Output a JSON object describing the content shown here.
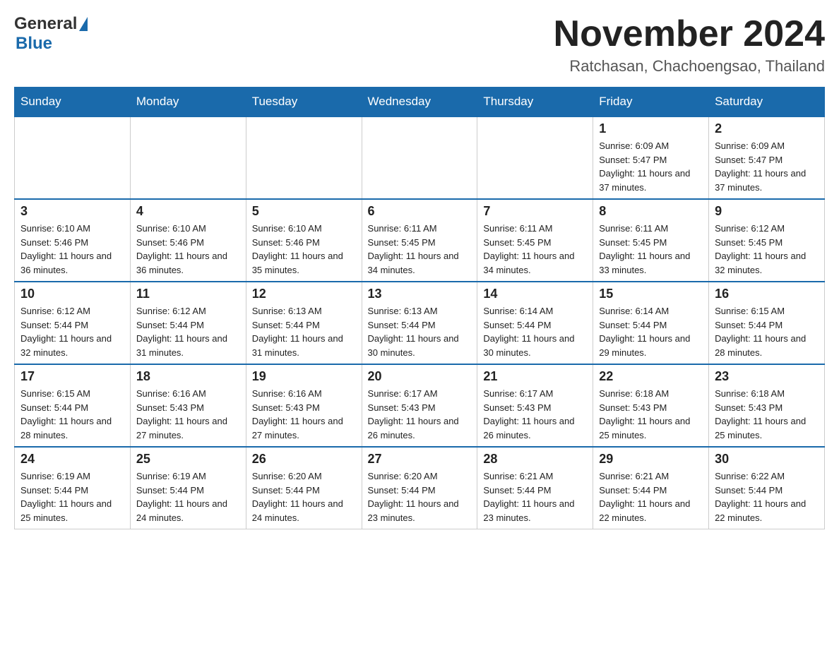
{
  "header": {
    "logo_general": "General",
    "logo_blue": "Blue",
    "month_title": "November 2024",
    "location": "Ratchasan, Chachoengsao, Thailand"
  },
  "weekdays": [
    "Sunday",
    "Monday",
    "Tuesday",
    "Wednesday",
    "Thursday",
    "Friday",
    "Saturday"
  ],
  "weeks": [
    [
      {
        "day": "",
        "info": ""
      },
      {
        "day": "",
        "info": ""
      },
      {
        "day": "",
        "info": ""
      },
      {
        "day": "",
        "info": ""
      },
      {
        "day": "",
        "info": ""
      },
      {
        "day": "1",
        "info": "Sunrise: 6:09 AM\nSunset: 5:47 PM\nDaylight: 11 hours and 37 minutes."
      },
      {
        "day": "2",
        "info": "Sunrise: 6:09 AM\nSunset: 5:47 PM\nDaylight: 11 hours and 37 minutes."
      }
    ],
    [
      {
        "day": "3",
        "info": "Sunrise: 6:10 AM\nSunset: 5:46 PM\nDaylight: 11 hours and 36 minutes."
      },
      {
        "day": "4",
        "info": "Sunrise: 6:10 AM\nSunset: 5:46 PM\nDaylight: 11 hours and 36 minutes."
      },
      {
        "day": "5",
        "info": "Sunrise: 6:10 AM\nSunset: 5:46 PM\nDaylight: 11 hours and 35 minutes."
      },
      {
        "day": "6",
        "info": "Sunrise: 6:11 AM\nSunset: 5:45 PM\nDaylight: 11 hours and 34 minutes."
      },
      {
        "day": "7",
        "info": "Sunrise: 6:11 AM\nSunset: 5:45 PM\nDaylight: 11 hours and 34 minutes."
      },
      {
        "day": "8",
        "info": "Sunrise: 6:11 AM\nSunset: 5:45 PM\nDaylight: 11 hours and 33 minutes."
      },
      {
        "day": "9",
        "info": "Sunrise: 6:12 AM\nSunset: 5:45 PM\nDaylight: 11 hours and 32 minutes."
      }
    ],
    [
      {
        "day": "10",
        "info": "Sunrise: 6:12 AM\nSunset: 5:44 PM\nDaylight: 11 hours and 32 minutes."
      },
      {
        "day": "11",
        "info": "Sunrise: 6:12 AM\nSunset: 5:44 PM\nDaylight: 11 hours and 31 minutes."
      },
      {
        "day": "12",
        "info": "Sunrise: 6:13 AM\nSunset: 5:44 PM\nDaylight: 11 hours and 31 minutes."
      },
      {
        "day": "13",
        "info": "Sunrise: 6:13 AM\nSunset: 5:44 PM\nDaylight: 11 hours and 30 minutes."
      },
      {
        "day": "14",
        "info": "Sunrise: 6:14 AM\nSunset: 5:44 PM\nDaylight: 11 hours and 30 minutes."
      },
      {
        "day": "15",
        "info": "Sunrise: 6:14 AM\nSunset: 5:44 PM\nDaylight: 11 hours and 29 minutes."
      },
      {
        "day": "16",
        "info": "Sunrise: 6:15 AM\nSunset: 5:44 PM\nDaylight: 11 hours and 28 minutes."
      }
    ],
    [
      {
        "day": "17",
        "info": "Sunrise: 6:15 AM\nSunset: 5:44 PM\nDaylight: 11 hours and 28 minutes."
      },
      {
        "day": "18",
        "info": "Sunrise: 6:16 AM\nSunset: 5:43 PM\nDaylight: 11 hours and 27 minutes."
      },
      {
        "day": "19",
        "info": "Sunrise: 6:16 AM\nSunset: 5:43 PM\nDaylight: 11 hours and 27 minutes."
      },
      {
        "day": "20",
        "info": "Sunrise: 6:17 AM\nSunset: 5:43 PM\nDaylight: 11 hours and 26 minutes."
      },
      {
        "day": "21",
        "info": "Sunrise: 6:17 AM\nSunset: 5:43 PM\nDaylight: 11 hours and 26 minutes."
      },
      {
        "day": "22",
        "info": "Sunrise: 6:18 AM\nSunset: 5:43 PM\nDaylight: 11 hours and 25 minutes."
      },
      {
        "day": "23",
        "info": "Sunrise: 6:18 AM\nSunset: 5:43 PM\nDaylight: 11 hours and 25 minutes."
      }
    ],
    [
      {
        "day": "24",
        "info": "Sunrise: 6:19 AM\nSunset: 5:44 PM\nDaylight: 11 hours and 25 minutes."
      },
      {
        "day": "25",
        "info": "Sunrise: 6:19 AM\nSunset: 5:44 PM\nDaylight: 11 hours and 24 minutes."
      },
      {
        "day": "26",
        "info": "Sunrise: 6:20 AM\nSunset: 5:44 PM\nDaylight: 11 hours and 24 minutes."
      },
      {
        "day": "27",
        "info": "Sunrise: 6:20 AM\nSunset: 5:44 PM\nDaylight: 11 hours and 23 minutes."
      },
      {
        "day": "28",
        "info": "Sunrise: 6:21 AM\nSunset: 5:44 PM\nDaylight: 11 hours and 23 minutes."
      },
      {
        "day": "29",
        "info": "Sunrise: 6:21 AM\nSunset: 5:44 PM\nDaylight: 11 hours and 22 minutes."
      },
      {
        "day": "30",
        "info": "Sunrise: 6:22 AM\nSunset: 5:44 PM\nDaylight: 11 hours and 22 minutes."
      }
    ]
  ]
}
